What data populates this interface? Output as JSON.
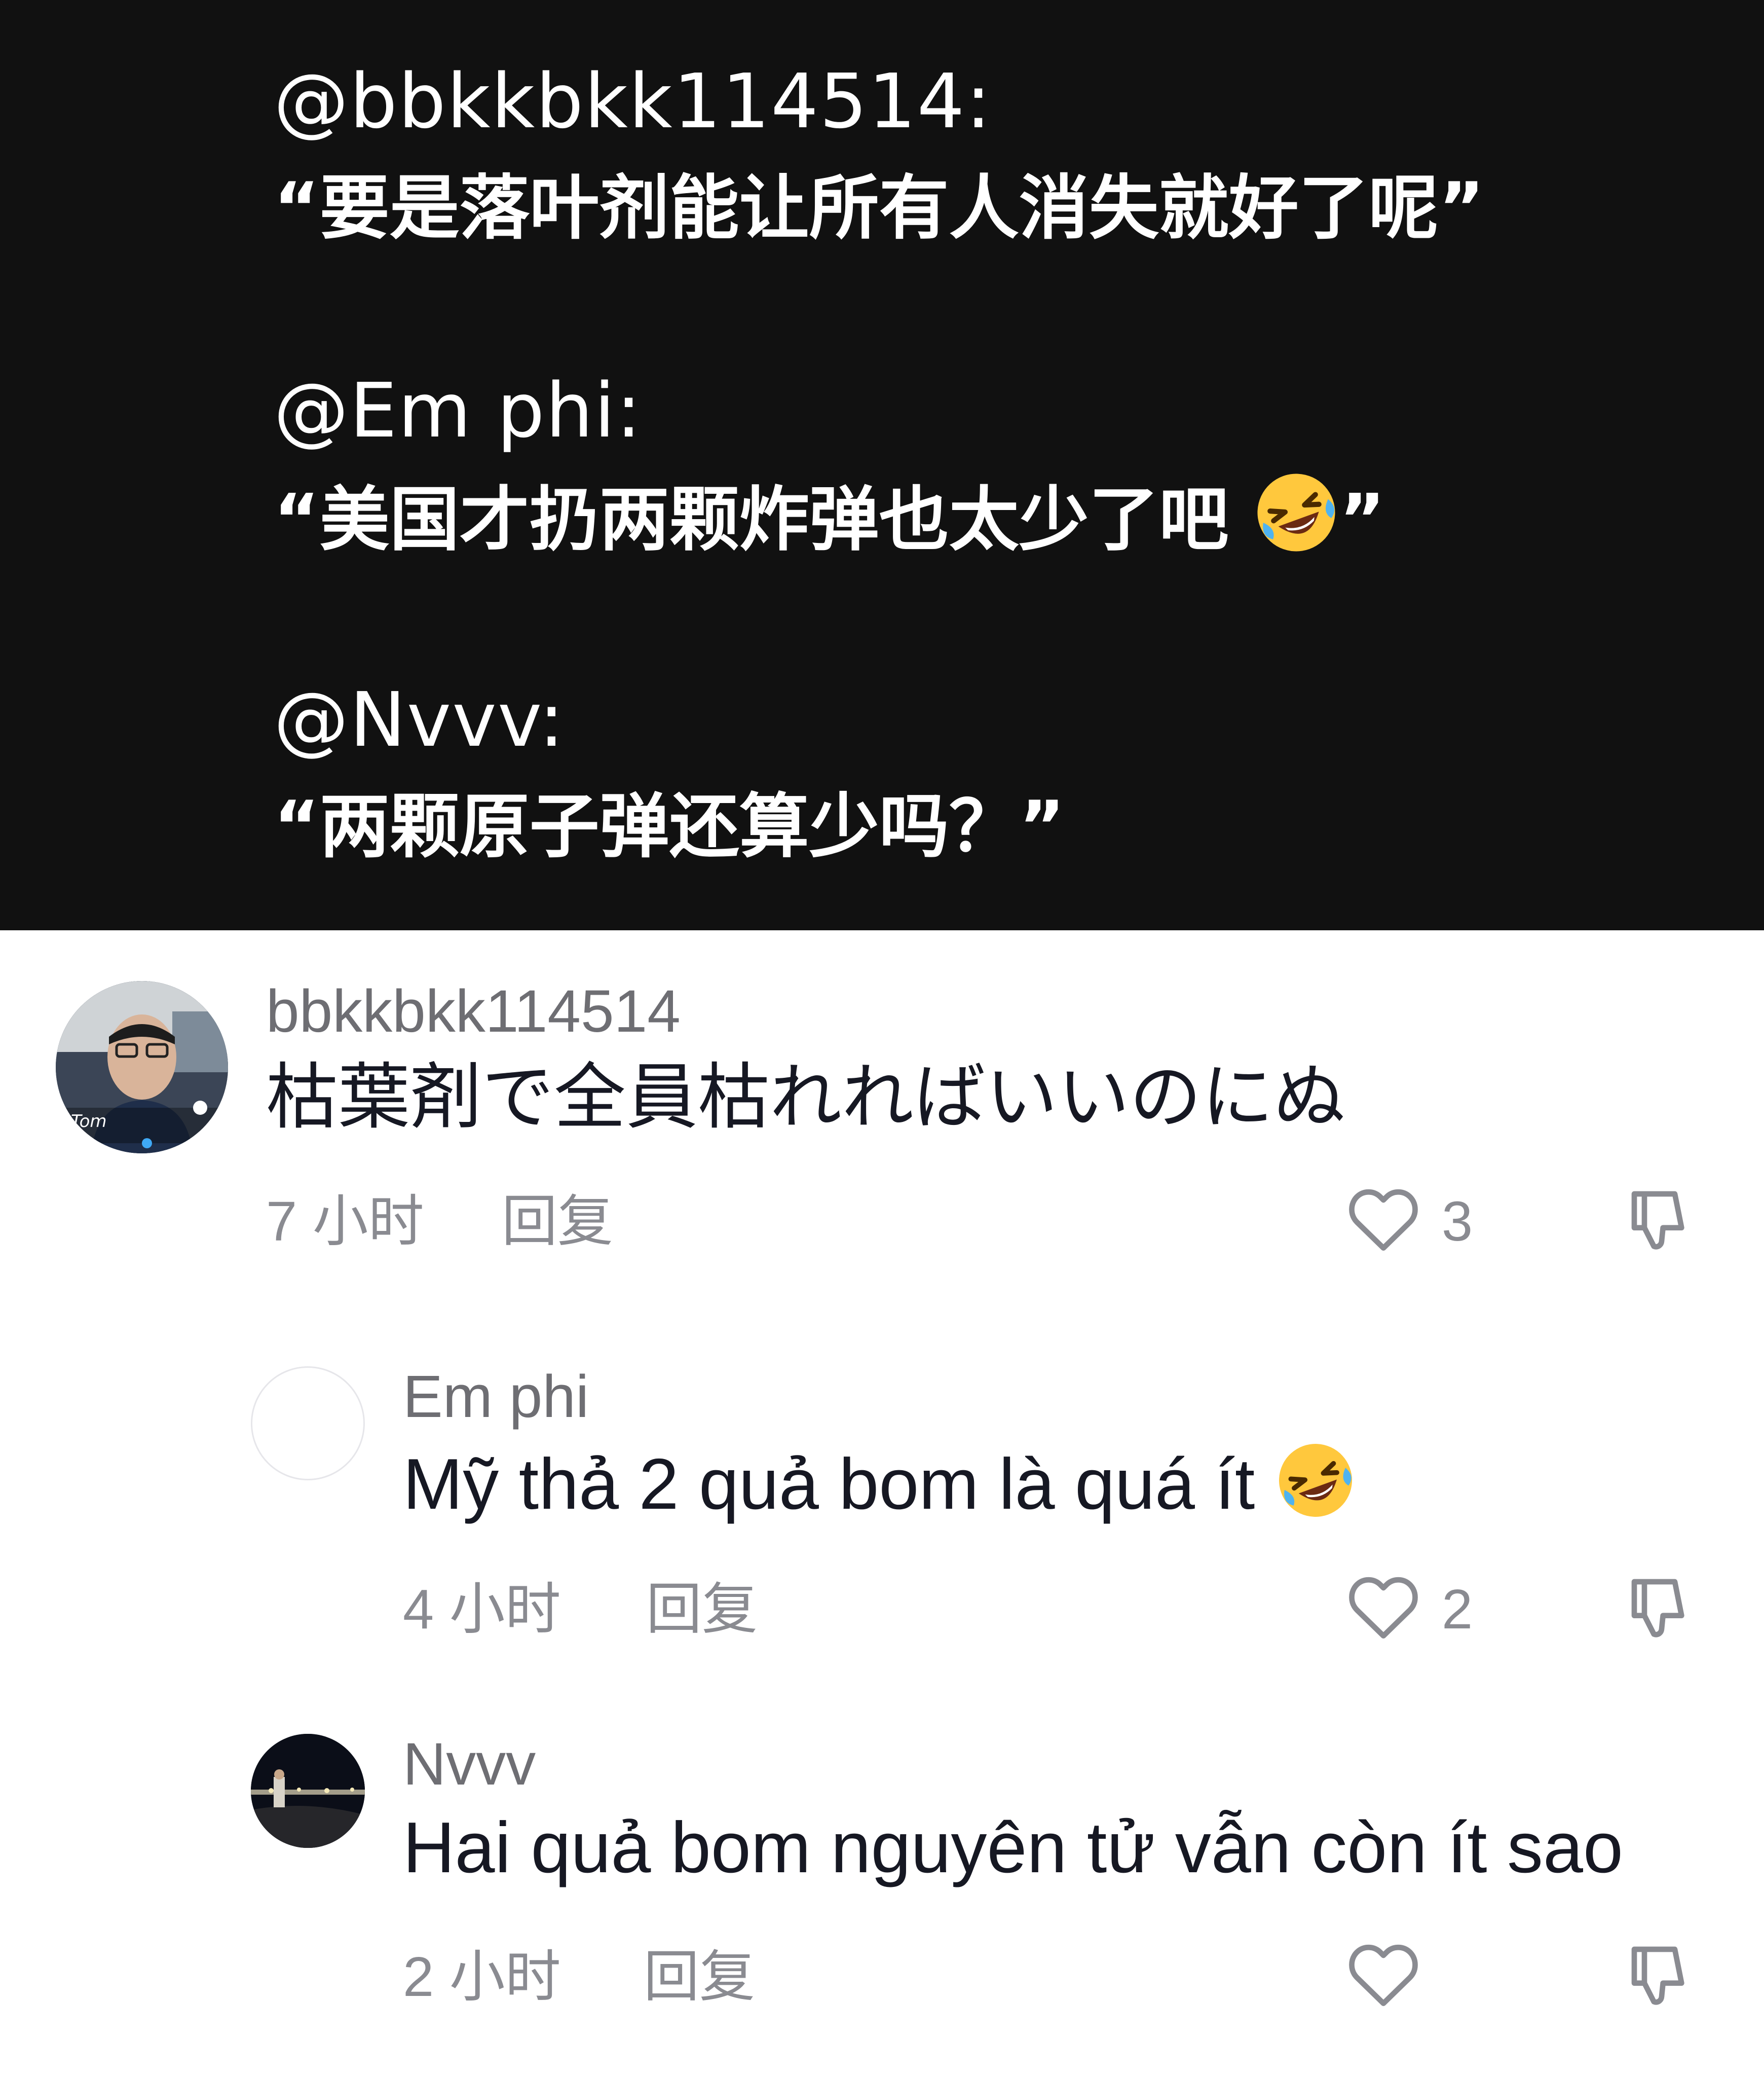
{
  "caption": {
    "quotes": [
      {
        "handle": "@bbkkbkk114514:",
        "text": "“要是落叶剂能让所有人消失就好了呢”",
        "emoji": ""
      },
      {
        "handle": "@Em phi:",
        "text": "“美国才扔两颗炸弹也太少了吧 ",
        "emoji": "rolling-laughing-emoji",
        "suffix": "”"
      },
      {
        "handle": "@Nvvv:",
        "text": "“两颗原子弹还算少吗？”",
        "emoji": ""
      }
    ]
  },
  "comments": [
    {
      "author": "bbkkbkk114514",
      "text": "枯葉剤で全員枯れればいいのにぬ",
      "time": "7 小时",
      "reply_label": "回复",
      "likes": "3",
      "avatar_caption": "Tom"
    },
    {
      "author": "Em phi",
      "text": "Mỹ thả 2 quả bom là quá ít ",
      "emoji": "rolling-laughing-emoji",
      "time": "4 小时",
      "reply_label": "回复",
      "likes": "2"
    },
    {
      "author": "Nvvv",
      "text": "Hai quả bom nguyên tử vẫn còn ít sao",
      "time": "2 小时",
      "reply_label": "回复",
      "likes": ""
    }
  ],
  "colors": {
    "panel_bg": "#111111",
    "text_primary": "#161823",
    "text_secondary": "#8a8b91",
    "author": "#6e6e73"
  },
  "icons": [
    "heart-icon",
    "dislike-icon",
    "rolling-laughing-emoji"
  ]
}
